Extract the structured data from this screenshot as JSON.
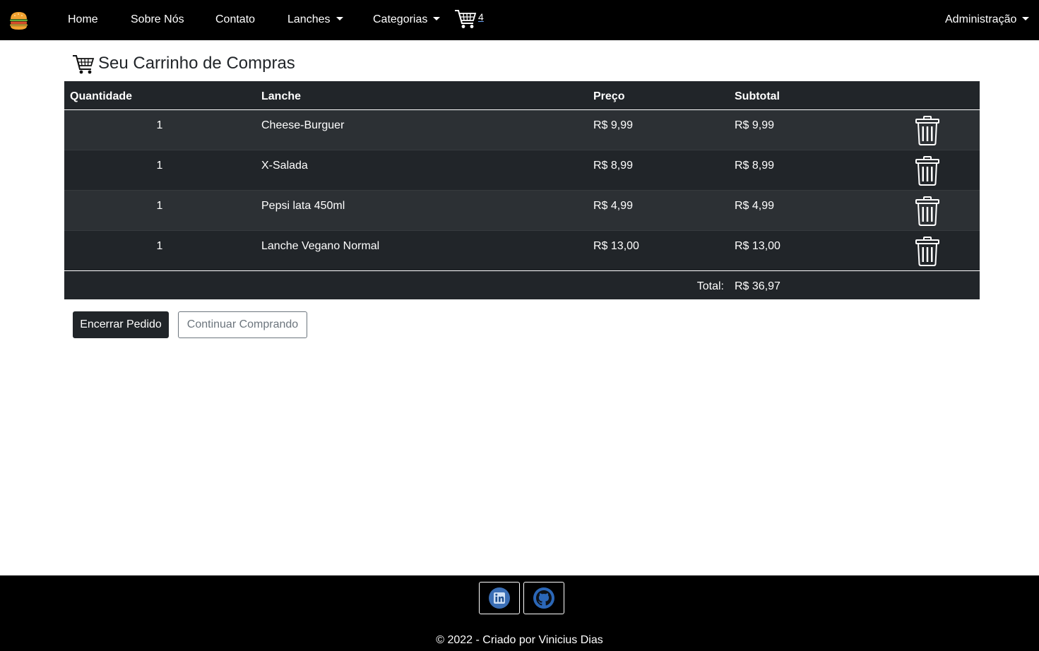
{
  "nav": {
    "brand_icon": "burger-logo",
    "items": [
      {
        "label": "Home"
      },
      {
        "label": "Sobre Nós"
      },
      {
        "label": "Contato"
      },
      {
        "label": "Lanches"
      },
      {
        "label": "Categorias"
      }
    ],
    "cart_icon": "shopping-cart-icon",
    "cart_count": "4",
    "admin_label": "Administração"
  },
  "page": {
    "title": "Seu Carrinho de Compras"
  },
  "table": {
    "headers": {
      "quantity": "Quantidade",
      "item": "Lanche",
      "price": "Preço",
      "subtotal": "Subtotal"
    },
    "rows": [
      {
        "quantity": "1",
        "item": "Cheese-Burguer",
        "price": "R$ 9,99",
        "subtotal": "R$ 9,99"
      },
      {
        "quantity": "1",
        "item": "X-Salada",
        "price": "R$ 8,99",
        "subtotal": "R$ 8,99"
      },
      {
        "quantity": "1",
        "item": "Pepsi lata 450ml",
        "price": "R$ 4,99",
        "subtotal": "R$ 4,99"
      },
      {
        "quantity": "1",
        "item": "Lanche Vegano Normal",
        "price": "R$ 13,00",
        "subtotal": "R$ 13,00"
      }
    ],
    "total_label": "Total:",
    "total_value": "R$ 36,97"
  },
  "actions": {
    "checkout_label": "Encerrar Pedido",
    "continue_label": "Continuar Comprando"
  },
  "footer": {
    "linkedin_icon": "linkedin-icon",
    "github_icon": "github-icon",
    "copyright": "© 2022 - Criado por Vinicius Dias"
  },
  "colors": {
    "navbar_bg": "#000000",
    "table_bg": "#212529",
    "table_stripe": "#2c3034",
    "accent_link": "#6ea8fe"
  }
}
